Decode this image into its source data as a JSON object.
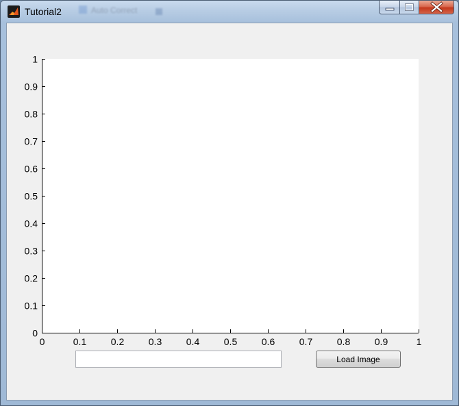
{
  "window": {
    "title": "Tutorial2",
    "background_ghost_text": "Auto Correct"
  },
  "controls": {
    "text_input_value": "",
    "load_button_label": "Load Image"
  },
  "colors": {
    "client_bg": "#f0f0f0",
    "axes_bg": "#ffffff",
    "close_button": "#c4381c"
  },
  "chart_data": {
    "type": "scatter",
    "title": "",
    "xlabel": "",
    "ylabel": "",
    "xlim": [
      0,
      1
    ],
    "ylim": [
      0,
      1
    ],
    "xticks": [
      0,
      0.1,
      0.2,
      0.3,
      0.4,
      0.5,
      0.6,
      0.7,
      0.8,
      0.9,
      1
    ],
    "yticks": [
      0,
      0.1,
      0.2,
      0.3,
      0.4,
      0.5,
      0.6,
      0.7,
      0.8,
      0.9,
      1
    ],
    "xtick_labels": [
      "0",
      "0.1",
      "0.2",
      "0.3",
      "0.4",
      "0.5",
      "0.6",
      "0.7",
      "0.8",
      "0.9",
      "1"
    ],
    "ytick_labels": [
      "0",
      "0.1",
      "0.2",
      "0.3",
      "0.4",
      "0.5",
      "0.6",
      "0.7",
      "0.8",
      "0.9",
      "1"
    ],
    "series": [],
    "grid": false
  }
}
